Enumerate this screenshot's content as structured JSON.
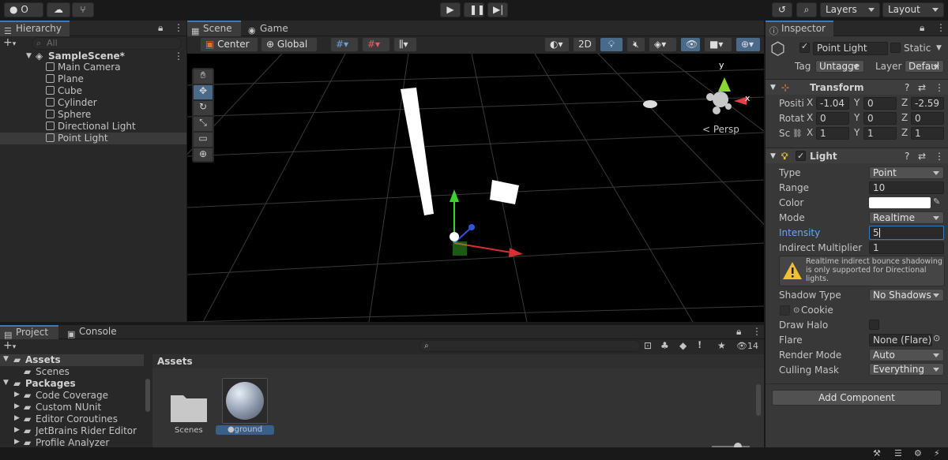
{
  "toolbar": {
    "account_label": "O",
    "layers_label": "Layers",
    "layout_label": "Layout"
  },
  "hierarchy": {
    "tab_label": "Hierarchy",
    "search_placeholder": "All",
    "scene_name": "SampleScene*",
    "items": [
      {
        "label": "Main Camera"
      },
      {
        "label": "Plane"
      },
      {
        "label": "Cube"
      },
      {
        "label": "Cylinder"
      },
      {
        "label": "Sphere"
      },
      {
        "label": "Directional Light"
      },
      {
        "label": "Point Light"
      }
    ]
  },
  "scene": {
    "tab_scene": "Scene",
    "tab_game": "Game",
    "pivot_mode": "Center",
    "pivot_rotation": "Global",
    "mode_2d": "2D",
    "persp_label": "< Persp",
    "axis_y": "y",
    "axis_x": "x"
  },
  "project": {
    "tab_project": "Project",
    "tab_console": "Console",
    "hidden_count": "14",
    "tree": [
      {
        "label": "Assets",
        "bold": true,
        "depth": 0
      },
      {
        "label": "Scenes",
        "bold": false,
        "depth": 1
      },
      {
        "label": "Packages",
        "bold": true,
        "depth": 0
      },
      {
        "label": "Code Coverage",
        "bold": false,
        "depth": 1
      },
      {
        "label": "Custom NUnit",
        "bold": false,
        "depth": 1
      },
      {
        "label": "Editor Coroutines",
        "bold": false,
        "depth": 1
      },
      {
        "label": "JetBrains Rider Editor",
        "bold": false,
        "depth": 1
      },
      {
        "label": "Profile Analyzer",
        "bold": false,
        "depth": 1
      }
    ],
    "breadcrumb": "Assets",
    "assets": [
      {
        "label": "Scenes",
        "icon": "folder-icon"
      },
      {
        "label": "ground",
        "icon": "material-sphere-icon"
      }
    ]
  },
  "inspector": {
    "tab_label": "Inspector",
    "object_name": "Point Light",
    "static_label": "Static",
    "tag_label": "Tag",
    "tag_value": "Untagge",
    "layer_label": "Layer",
    "layer_value": "Defaul",
    "transform": {
      "title": "Transform",
      "rows": [
        {
          "label": "Positi",
          "x": "-1.04",
          "y": "0",
          "z": "-2.59"
        },
        {
          "label": "Rotati",
          "x": "0",
          "y": "0",
          "z": "0"
        },
        {
          "label": "Sc",
          "x": "1",
          "y": "1",
          "z": "1"
        }
      ]
    },
    "light": {
      "title": "Light",
      "type_label": "Type",
      "type_value": "Point",
      "range_label": "Range",
      "range_value": "10",
      "color_label": "Color",
      "color_value": "#ffffff",
      "mode_label": "Mode",
      "mode_value": "Realtime",
      "intensity_label": "Intensity",
      "intensity_value": "5",
      "indirect_label": "Indirect Multiplier",
      "indirect_value": "1",
      "warning_text": "Realtime indirect bounce shadowing is only supported for Directional lights.",
      "shadow_label": "Shadow Type",
      "shadow_value": "No Shadows",
      "cookie_label": "Cookie",
      "halo_label": "Draw Halo",
      "flare_label": "Flare",
      "flare_value": "None (Flare)",
      "render_label": "Render Mode",
      "render_value": "Auto",
      "culling_label": "Culling Mask",
      "culling_value": "Everything"
    },
    "add_component": "Add Component"
  },
  "colors": {
    "accent": "#3a79bb",
    "panel": "#383838",
    "background": "#191919"
  }
}
